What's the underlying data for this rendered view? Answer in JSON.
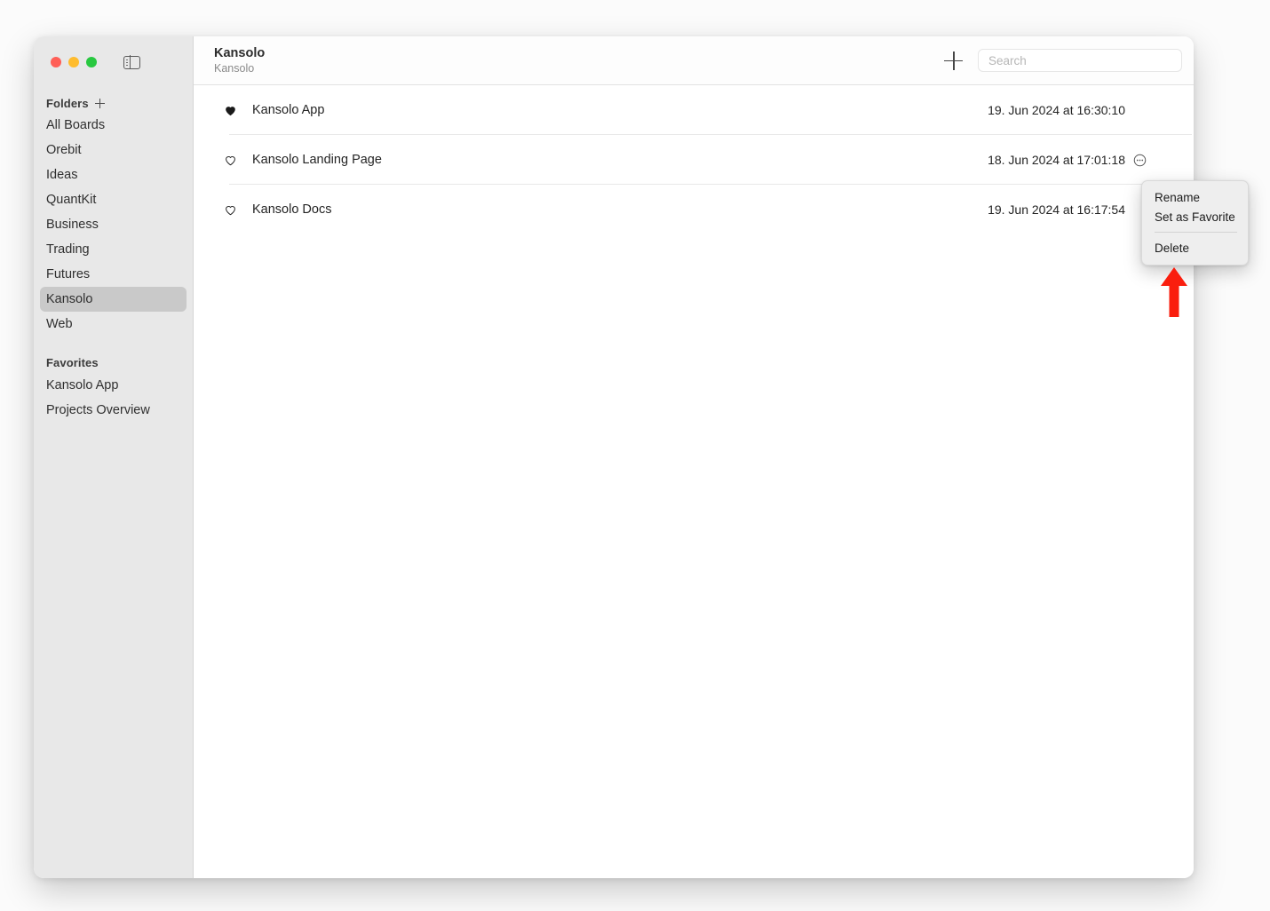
{
  "window": {
    "traffic_lights": [
      "close",
      "minimize",
      "zoom"
    ],
    "sidebar_toggle_icon": "sidebar-toggle-icon"
  },
  "sidebar": {
    "folders_section": {
      "label": "Folders",
      "add_icon": "plus-icon",
      "items": [
        {
          "label": "All Boards",
          "selected": false
        },
        {
          "label": "Orebit",
          "selected": false
        },
        {
          "label": "Ideas",
          "selected": false
        },
        {
          "label": "QuantKit",
          "selected": false
        },
        {
          "label": "Business",
          "selected": false
        },
        {
          "label": "Trading",
          "selected": false
        },
        {
          "label": "Futures",
          "selected": false
        },
        {
          "label": "Kansolo",
          "selected": true
        },
        {
          "label": "Web",
          "selected": false
        }
      ]
    },
    "favorites_section": {
      "label": "Favorites",
      "items": [
        {
          "label": "Kansolo App"
        },
        {
          "label": "Projects Overview"
        }
      ]
    }
  },
  "toolbar": {
    "title": "Kansolo",
    "subtitle": "Kansolo",
    "add_icon": "plus-icon",
    "search": {
      "placeholder": "Search",
      "value": "",
      "icon": "search-input"
    }
  },
  "board_list": {
    "rows": [
      {
        "name": "Kansolo App",
        "date": "19. Jun 2024 at 16:30:10",
        "favorite": true,
        "active": false
      },
      {
        "name": "Kansolo Landing Page",
        "date": "18. Jun 2024 at 17:01:18",
        "favorite": false,
        "active": true
      },
      {
        "name": "Kansolo Docs",
        "date": "19. Jun 2024 at 16:17:54",
        "favorite": false,
        "active": false
      }
    ]
  },
  "context_menu": {
    "items": [
      {
        "label": "Rename"
      },
      {
        "label": "Set as Favorite"
      },
      {
        "label": "Delete"
      }
    ]
  },
  "annotation": {
    "type": "arrow-up",
    "color": "#fa1e0e"
  }
}
